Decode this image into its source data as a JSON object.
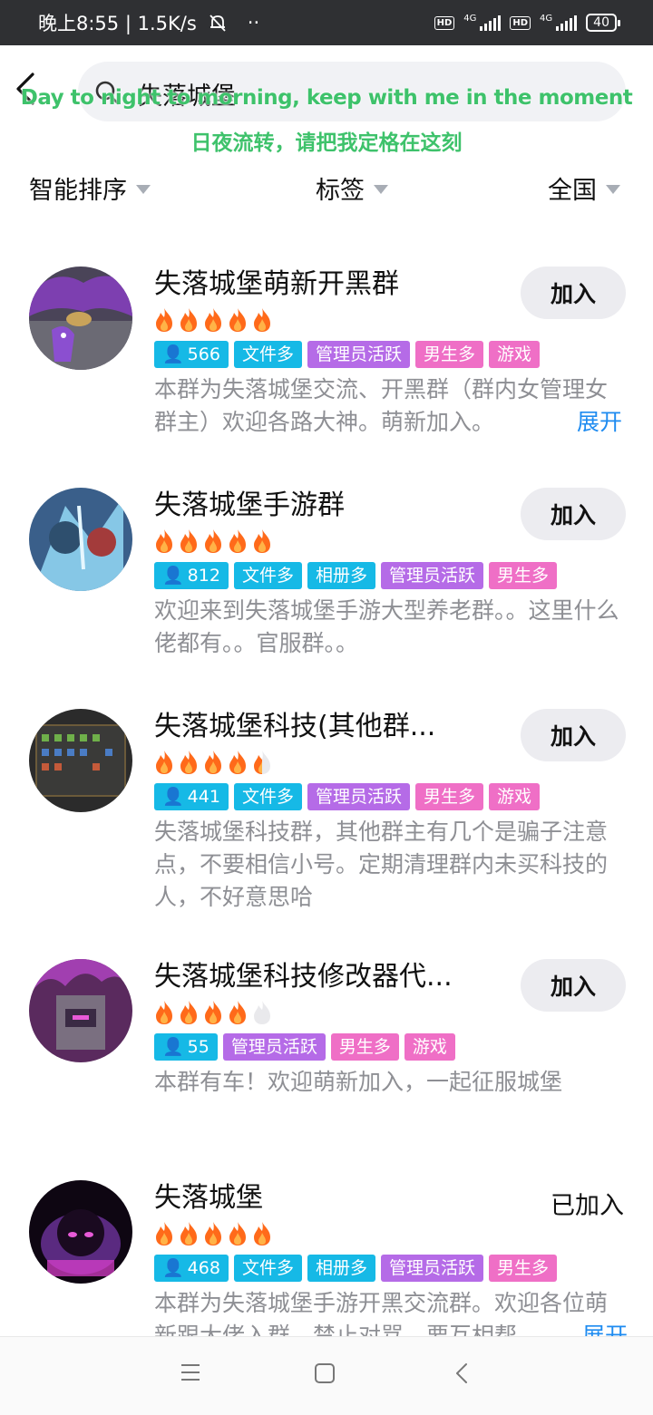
{
  "status": {
    "time_speed": "晚上8:55 | 1.5K/s",
    "dots": "··",
    "hd1": "HD",
    "net1": "4G",
    "hd2": "HD",
    "net2": "4G",
    "battery": "40"
  },
  "search": {
    "query": "失落城堡"
  },
  "overlay": {
    "lyric_en": "Day to night to morning, keep with me in the moment",
    "lyric_zh": "日夜流转，请把我定格在这刻"
  },
  "filters": {
    "sort": "智能排序",
    "tags": "标签",
    "region": "全国"
  },
  "groups": [
    {
      "name": "失落城堡萌新开黑群",
      "flames": 5,
      "members": "566",
      "tags": [
        "文件多",
        "管理员活跃",
        "男生多",
        "游戏"
      ],
      "desc": "本群为失落城堡交流、开黑群（群内女管理女群主）欢迎各路大神。萌新加入。",
      "expand": "展开",
      "action": "加入"
    },
    {
      "name": "失落城堡手游群",
      "flames": 5,
      "members": "812",
      "tags": [
        "文件多",
        "相册多",
        "管理员活跃",
        "男生多"
      ],
      "desc": "欢迎来到失落城堡手游大型养老群。。这里什么佬都有。。官服群。。",
      "action": "加入"
    },
    {
      "name": "失落城堡科技(其他群...",
      "flames": 4.5,
      "members": "441",
      "tags": [
        "文件多",
        "管理员活跃",
        "男生多",
        "游戏"
      ],
      "desc": "失落城堡科技群，其他群主有几个是骗子注意点，不要相信小号。定期清理群内未买科技的人，不好意思哈",
      "action": "加入"
    },
    {
      "name": "失落城堡科技修改器代...",
      "flames": 4,
      "members": "55",
      "tags": [
        "管理员活跃",
        "男生多",
        "游戏"
      ],
      "desc": "本群有车！欢迎萌新加入，一起征服城堡",
      "action": "加入"
    },
    {
      "name": "失落城堡",
      "flames": 5,
      "members": "468",
      "tags": [
        "文件多",
        "相册多",
        "管理员活跃",
        "男生多"
      ],
      "desc": "本群为失落城堡手游开黑交流群。欢迎各位萌新跟大佬入群，禁止对骂，要互相帮",
      "expand": "展开",
      "action": "已加入"
    }
  ],
  "colors": {
    "accent": "#1e8bf0",
    "tag_blue": "#16b9e6",
    "tag_purple": "#b56be7",
    "tag_pink": "#ef6fc6",
    "flame": "#ff6a1a",
    "lyric": "#3ec26b"
  },
  "icons": {
    "back": "chevron-left-icon",
    "search": "search-icon",
    "member": "person-icon",
    "flame": "flame-icon",
    "nav_menu": "menu-icon",
    "nav_home": "square-icon",
    "nav_back": "back-icon"
  }
}
